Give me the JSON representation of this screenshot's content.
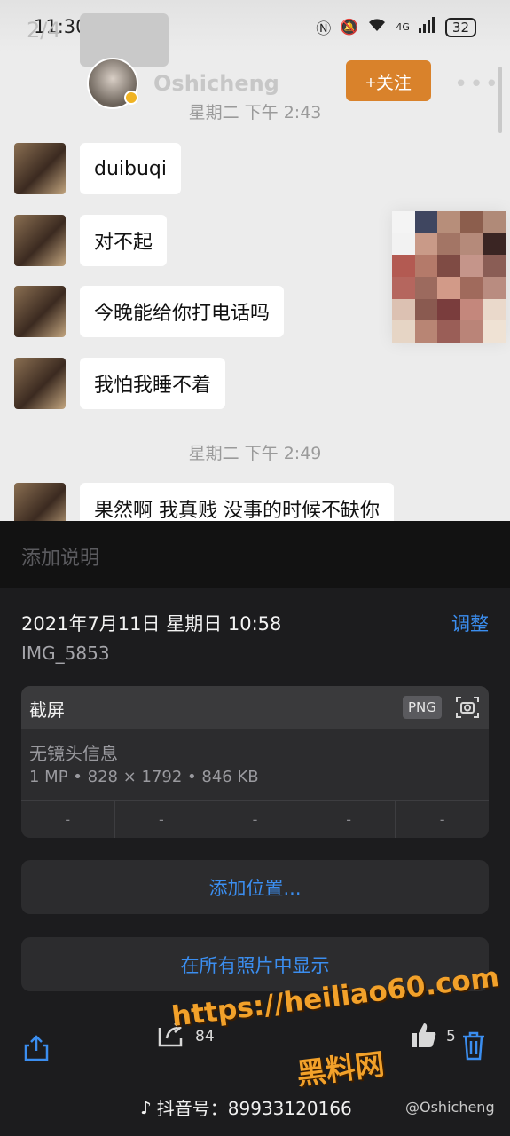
{
  "status_bar": {
    "time": "11:30",
    "battery": "32",
    "network": "4G"
  },
  "chat_header": {
    "count": "2/4",
    "name": "Oshicheng",
    "follow_label": "+关注",
    "more": "•••"
  },
  "timestamps": [
    "星期二 下午 2:43",
    "星期二 下午 2:49"
  ],
  "messages": [
    {
      "text": "duibuqi"
    },
    {
      "text": "对不起"
    },
    {
      "text": "今晚能给你打电话吗"
    },
    {
      "text": "我怕我睡不着"
    },
    {
      "text": "果然啊 我真贱 没事的时候不缺你"
    }
  ],
  "sheet": {
    "caption_placeholder": "添加说明",
    "date": "2021年7月11日 星期日 10:58",
    "adjust": "调整",
    "filename": "IMG_5853",
    "type": "截屏",
    "format_badge": "PNG",
    "lens_info": "无镜头信息",
    "specs": "1 MP • 828 × 1792 • 846 KB",
    "dashes": [
      "-",
      "-",
      "-",
      "-",
      "-"
    ],
    "add_location": "添加位置...",
    "show_all": "在所有照片中显示"
  },
  "toolbar": {
    "share_count": "84",
    "like_count": "5"
  },
  "overlay": {
    "watermark_url": "https://heiliao60.com",
    "watermark_name": "黑料网",
    "douyin": "抖音号：89933120166",
    "weibo": "@Oshicheng"
  },
  "colors": {
    "accent_blue": "#3b8ef0",
    "follow_orange": "#d9822b",
    "watermark_orange": "#f2a12a"
  }
}
